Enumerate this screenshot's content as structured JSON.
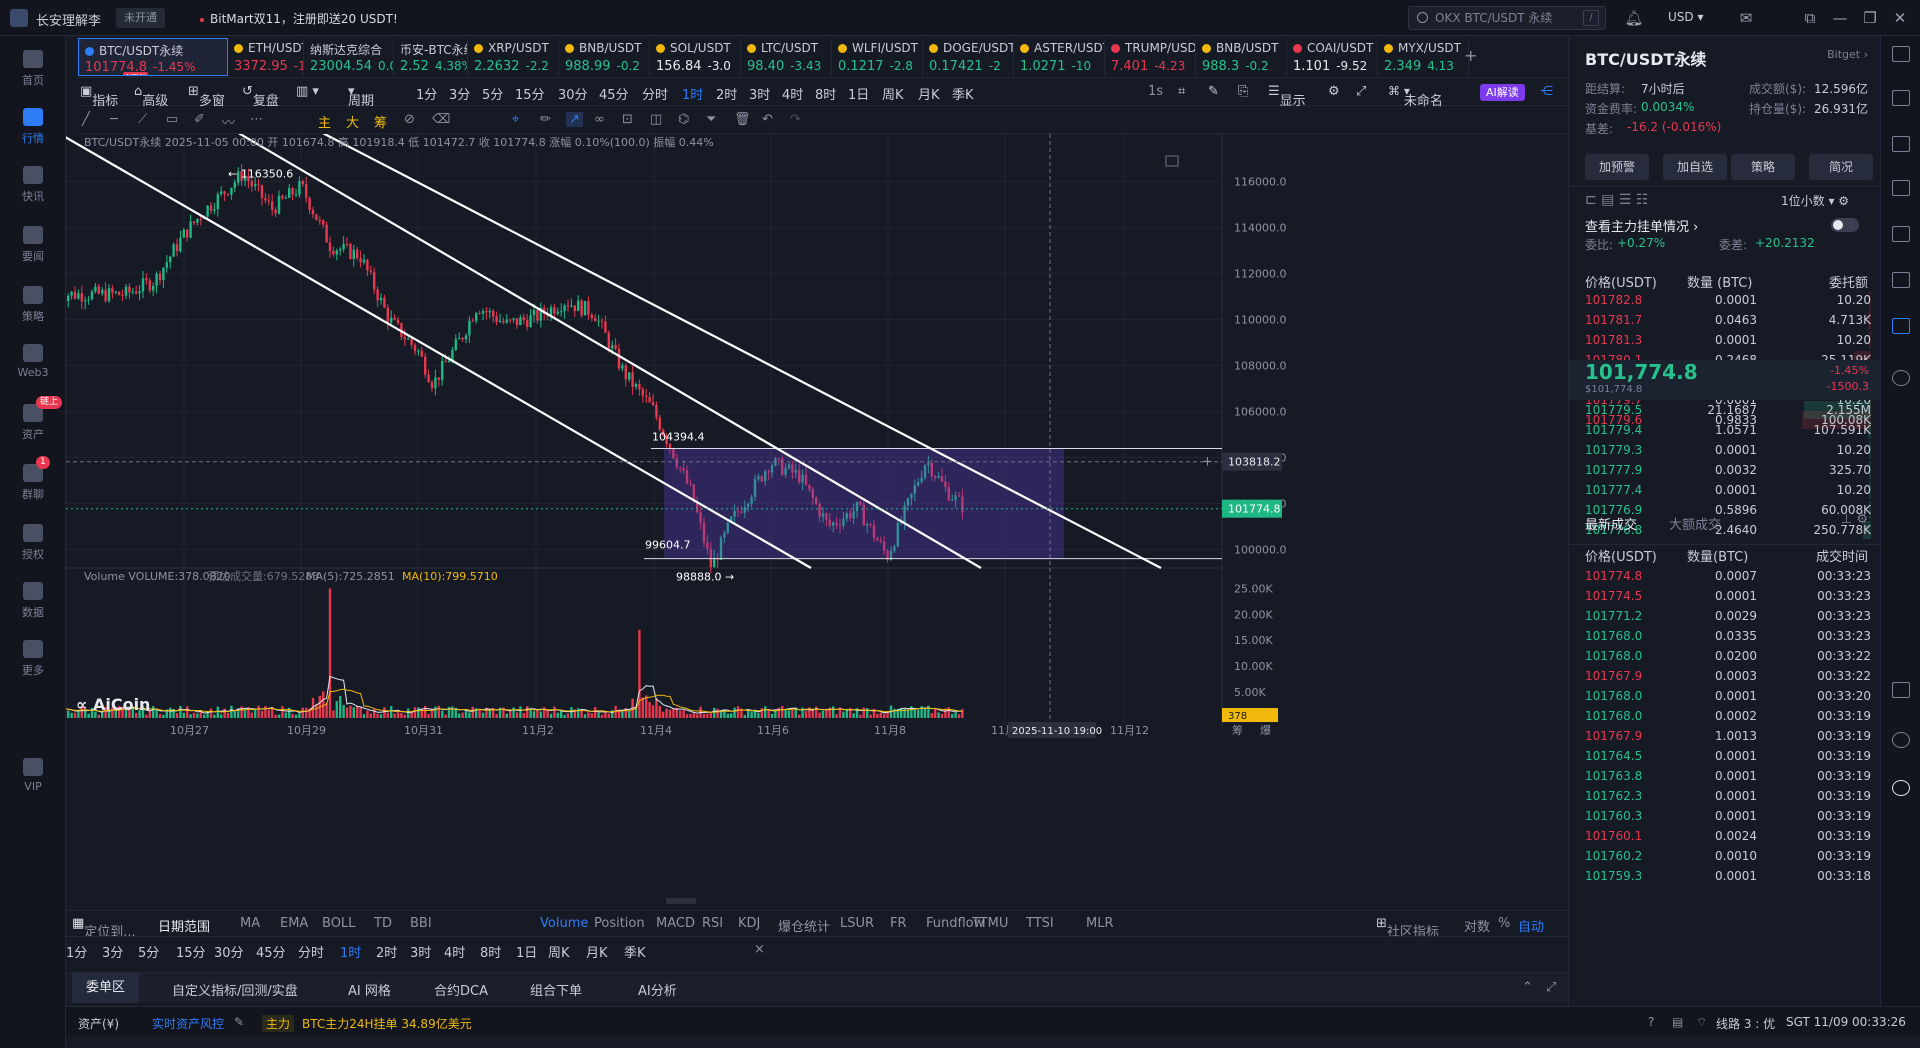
{
  "window": {
    "app_name": "长安理解李",
    "status_pill": "未开通",
    "promo": "BitMart双11，注册即送20 USDT!",
    "search_placeholder": "OKX BTC/USDT 永续",
    "search_shortcut": "/",
    "currency": "USD"
  },
  "leftnav": [
    {
      "label": "首页",
      "icon": "home-icon"
    },
    {
      "label": "行情",
      "icon": "chart-bars-icon",
      "active": true
    },
    {
      "label": "快讯",
      "icon": "flash-news-icon"
    },
    {
      "label": "要闻",
      "icon": "news-icon"
    },
    {
      "label": "策略",
      "icon": "strategy-icon"
    },
    {
      "label": "Web3",
      "icon": "web3-icon"
    },
    {
      "label": "资产",
      "icon": "wallet-icon",
      "badge": "链上"
    },
    {
      "label": "群聊",
      "icon": "chat-icon",
      "badge": "1"
    },
    {
      "label": "授权",
      "icon": "authorize-icon"
    },
    {
      "label": "数据",
      "icon": "data-icon"
    },
    {
      "label": "更多",
      "icon": "more-grid-icon"
    },
    {
      "label": "VIP",
      "icon": "vip-icon"
    }
  ],
  "tickers": [
    {
      "name": "BTC/USDT永续",
      "price": "101774.8",
      "change": "-1.45%",
      "dir": "red",
      "dot": "#2e7cf6",
      "selected": true,
      "new": "NEW"
    },
    {
      "name": "ETH/USDT",
      "price": "3372.95",
      "change": "-1",
      "dir": "red",
      "dot": "#f0b90b"
    },
    {
      "name": "纳斯达克综合",
      "price": "23004.54",
      "change": "0.07",
      "dir": "green",
      "dot": ""
    },
    {
      "name": "币安-BTC永续",
      "price": "2.52",
      "change": "4.38%",
      "dir": "green",
      "dot": ""
    },
    {
      "name": "XRP/USDT",
      "price": "2.2632",
      "change": "-2.2",
      "dir": "green",
      "dot": "#f0b90b"
    },
    {
      "name": "BNB/USDT",
      "price": "988.99",
      "change": "-0.2",
      "dir": "green",
      "dot": "#f0b90b"
    },
    {
      "name": "SOL/USDT",
      "price": "156.84",
      "change": "-3.0",
      "dir": "white",
      "dot": "#f0b90b"
    },
    {
      "name": "LTC/USDT",
      "price": "98.40",
      "change": "-3.43",
      "dir": "green",
      "dot": "#f0b90b"
    },
    {
      "name": "WLFI/USDT",
      "price": "0.1217",
      "change": "-2.8",
      "dir": "green",
      "dot": "#f0b90b"
    },
    {
      "name": "DOGE/USDT",
      "price": "0.17421",
      "change": "-2",
      "dir": "green",
      "dot": "#f0b90b"
    },
    {
      "name": "ASTER/USDT",
      "price": "1.0271",
      "change": "-10",
      "dir": "green",
      "dot": "#f0b90b"
    },
    {
      "name": "TRUMP/USDT",
      "price": "7.401",
      "change": "-4.23",
      "dir": "red",
      "dot": "#e8384f"
    },
    {
      "name": "BNB/USDT",
      "price": "988.3",
      "change": "-0.2",
      "dir": "green",
      "dot": "#f0b90b"
    },
    {
      "name": "COAI/USDT",
      "price": "1.101",
      "change": "-9.52",
      "dir": "white",
      "dot": "#e8384f"
    },
    {
      "name": "MYX/USDT",
      "price": "2.349",
      "change": "4.13",
      "dir": "green",
      "dot": "#f0b90b"
    }
  ],
  "toolbar1": {
    "indicators": "指标",
    "advanced": "高级",
    "multi": "多窗",
    "replay": "复盘",
    "period": "周期",
    "timeframes": [
      "1分",
      "3分",
      "5分",
      "15分",
      "30分",
      "45分",
      "分时",
      "1时",
      "2时",
      "3时",
      "4时",
      "8时",
      "1日",
      "周K",
      "月K",
      "季K"
    ],
    "active_tf": "1时",
    "interval": "1s",
    "display": "显示",
    "unnamed": "未命名",
    "ai": "AI解读"
  },
  "toolbar2": {
    "main": "主",
    "big": "大",
    "chips": "筹"
  },
  "chart": {
    "legend": "BTC/USDT永续  2025-11-05 00:00 开 101674.8 高 101918.4 低 101472.7 收 101774.8 涨幅 0.10%(100.0) 振幅 0.44%",
    "volume_legend": "Volume  VOLUME:378.0820",
    "volume_est": "预估成交量:679.5283",
    "volume_ma5": "MA(5):725.2851",
    "volume_ma10": "MA(10):799.5710",
    "watermark": "AiCoin",
    "annotations": {
      "high": "116350.6",
      "level1": "104394.4",
      "level2": "99604.7",
      "low": "98888.0",
      "crosshair_price": "103818.2",
      "current_price": "101774.8",
      "crosshair_time": "2025-11-10 19:00",
      "volume_last": "378"
    },
    "y_ticks": [
      "116000.0",
      "114000.0",
      "112000.0",
      "110000.0",
      "108000.0",
      "106000.0",
      "104000.0",
      "102000.0",
      "100000.0"
    ],
    "vol_ticks": [
      "25.00K",
      "20.00K",
      "15.00K",
      "10.00K",
      "5.00K"
    ],
    "x_ticks": [
      "10月27",
      "10月29",
      "10月31",
      "11月2",
      "11月4",
      "11月6",
      "11月8",
      "11月10",
      "11月12"
    ],
    "corner": [
      "筹",
      "爆"
    ]
  },
  "chart_data": {
    "type": "candlestick",
    "symbol": "BTC/USDT永续",
    "interval": "1时",
    "ylim": [
      99000,
      117500
    ],
    "close_path": [
      {
        "t": "10月26",
        "p": 111100
      },
      {
        "t": "10月26 12:00",
        "p": 111700
      },
      {
        "t": "10月27",
        "p": 113700
      },
      {
        "t": "10月27 08:00",
        "p": 114700
      },
      {
        "t": "10月27 16:00",
        "p": 115500
      },
      {
        "t": "10月28",
        "p": 116350
      },
      {
        "t": "10月28 12:00",
        "p": 114800
      },
      {
        "t": "10月29",
        "p": 115800
      },
      {
        "t": "10月29 12:00",
        "p": 113200
      },
      {
        "t": "10月30",
        "p": 112800
      },
      {
        "t": "10月30 12:00",
        "p": 110000
      },
      {
        "t": "10月31",
        "p": 108600
      },
      {
        "t": "10月31 06:00",
        "p": 107200
      },
      {
        "t": "10月31 18:00",
        "p": 109300
      },
      {
        "t": "11月1",
        "p": 110600
      },
      {
        "t": "11月1 12:00",
        "p": 109800
      },
      {
        "t": "11月2",
        "p": 110100
      },
      {
        "t": "11月2 12:00",
        "p": 110800
      },
      {
        "t": "11月3",
        "p": 110300
      },
      {
        "t": "11月3 12:00",
        "p": 107700
      },
      {
        "t": "11月4",
        "p": 106100
      },
      {
        "t": "11月4 08:00",
        "p": 104300
      },
      {
        "t": "11月4 16:00",
        "p": 102400
      },
      {
        "t": "11月5",
        "p": 99200
      },
      {
        "t": "11月5 08:00",
        "p": 101200
      },
      {
        "t": "11月5 18:00",
        "p": 102800
      },
      {
        "t": "11月6",
        "p": 103800
      },
      {
        "t": "11月6 12:00",
        "p": 103200
      },
      {
        "t": "11月7",
        "p": 101000
      },
      {
        "t": "11月7 12:00",
        "p": 101800
      },
      {
        "t": "11月8",
        "p": 99700
      },
      {
        "t": "11月8 08:00",
        "p": 101800
      },
      {
        "t": "11月8 16:00",
        "p": 103900
      },
      {
        "t": "11月9",
        "p": 102600
      },
      {
        "t": "11月9 08:00",
        "p": 101775
      }
    ],
    "volume_peaks": [
      {
        "t": "10月29 12:00",
        "v": 25000
      },
      {
        "t": "11月3 18:00",
        "v": 17000
      }
    ]
  },
  "indicator_tabs": {
    "locate": "定位到...",
    "range": "日期范围",
    "items": [
      "MA",
      "EMA",
      "BOLL",
      "TD",
      "BBI",
      "Volume",
      "Position",
      "MACD",
      "RSI",
      "KDJ",
      "爆仓统计",
      "LSUR",
      "FR",
      "Fundflow",
      "TTMU",
      "TTSI",
      "MLR"
    ],
    "active": "Volume",
    "community": "社区指标",
    "log": "对数",
    "pct": "%",
    "auto": "自动"
  },
  "tf_tabs": {
    "items": [
      "1分",
      "3分",
      "5分",
      "15分",
      "30分",
      "45分",
      "分时",
      "1时",
      "2时",
      "3时",
      "4时",
      "8时",
      "1日",
      "周K",
      "月K",
      "季K"
    ],
    "active": "1时"
  },
  "order_tabs": [
    "委单区",
    "自定义指标/回测/实盘",
    "AI 网格",
    "合约DCA",
    "组合下单",
    "AI分析"
  ],
  "status": {
    "assets": "资产(¥)",
    "risk": "实时资产风控",
    "main": "主力",
    "main_info": "BTC主力24H挂单 34.89亿美元",
    "line": "线路 3 : 优",
    "time": "SGT 11/09 00:33:26"
  },
  "panel": {
    "symbol": "BTC/USDT永续",
    "exchange": "Bitget",
    "settle_label": "距结算:",
    "settle": "7小时后",
    "turnover_label": "成交额($):",
    "turnover": "12.596亿",
    "funding_label": "资金费率:",
    "funding": "0.0034%",
    "oi_label": "持仓量($):",
    "oi": "26.931亿",
    "basis_label": "基差:",
    "basis": "-16.2 (-0.016%)",
    "buttons": [
      "加预警",
      "加自选",
      "策略",
      "简况"
    ],
    "decimals": "1位小数",
    "main_orders": "查看主力挂单情况",
    "ratio_label": "委比:",
    "ratio": "+0.27%",
    "diff_label": "委差:",
    "diff": "+20.2132",
    "ob_head": [
      "价格(USDT)",
      "数量 (BTC)",
      "委托额"
    ],
    "asks": [
      [
        "101782.8",
        "0.0001",
        "10.20"
      ],
      [
        "101781.7",
        "0.0463",
        "4.713K"
      ],
      [
        "101781.3",
        "0.0001",
        "10.20"
      ],
      [
        "101780.1",
        "0.2468",
        "25.119K"
      ],
      [
        "101779.8",
        "0.0001",
        "10.20"
      ],
      [
        "101779.7",
        "0.0001",
        "10.20"
      ],
      [
        "101779.6",
        "0.9833",
        "100.08K"
      ]
    ],
    "last_price": "101,774.8",
    "last_sub": "$101,774.8",
    "last_pct": "-1.45%",
    "last_chg": "-1500.3",
    "bids": [
      [
        "101779.5",
        "21.1687",
        "2.155M"
      ],
      [
        "101779.4",
        "1.0571",
        "107.591K"
      ],
      [
        "101779.3",
        "0.0001",
        "10.20"
      ],
      [
        "101777.9",
        "0.0032",
        "325.70"
      ],
      [
        "101777.4",
        "0.0001",
        "10.20"
      ],
      [
        "101776.9",
        "0.5896",
        "60.008K"
      ],
      [
        "101776.8",
        "2.4640",
        "250.778K"
      ]
    ],
    "trade_tabs": [
      "最新成交",
      "大额成交"
    ],
    "trade_head": [
      "价格(USDT)",
      "数量(BTC)",
      "成交时间"
    ],
    "trades": [
      [
        "101774.8",
        "0.0007",
        "00:33:23",
        "red"
      ],
      [
        "101774.5",
        "0.0001",
        "00:33:23",
        "red"
      ],
      [
        "101771.2",
        "0.0029",
        "00:33:23",
        "green"
      ],
      [
        "101768.0",
        "0.0335",
        "00:33:23",
        "green"
      ],
      [
        "101768.0",
        "0.0200",
        "00:33:22",
        "green"
      ],
      [
        "101767.9",
        "0.0003",
        "00:33:22",
        "red"
      ],
      [
        "101768.0",
        "0.0001",
        "00:33:20",
        "green"
      ],
      [
        "101768.0",
        "0.0002",
        "00:33:19",
        "green"
      ],
      [
        "101767.9",
        "1.0013",
        "00:33:19",
        "red"
      ],
      [
        "101764.5",
        "0.0001",
        "00:33:19",
        "green"
      ],
      [
        "101763.8",
        "0.0001",
        "00:33:19",
        "green"
      ],
      [
        "101762.3",
        "0.0001",
        "00:33:19",
        "green"
      ],
      [
        "101760.3",
        "0.0001",
        "00:33:19",
        "green"
      ],
      [
        "101760.1",
        "0.0024",
        "00:33:19",
        "red"
      ],
      [
        "101760.2",
        "0.0010",
        "00:33:19",
        "green"
      ],
      [
        "101759.3",
        "0.0001",
        "00:33:18",
        "green"
      ]
    ]
  }
}
